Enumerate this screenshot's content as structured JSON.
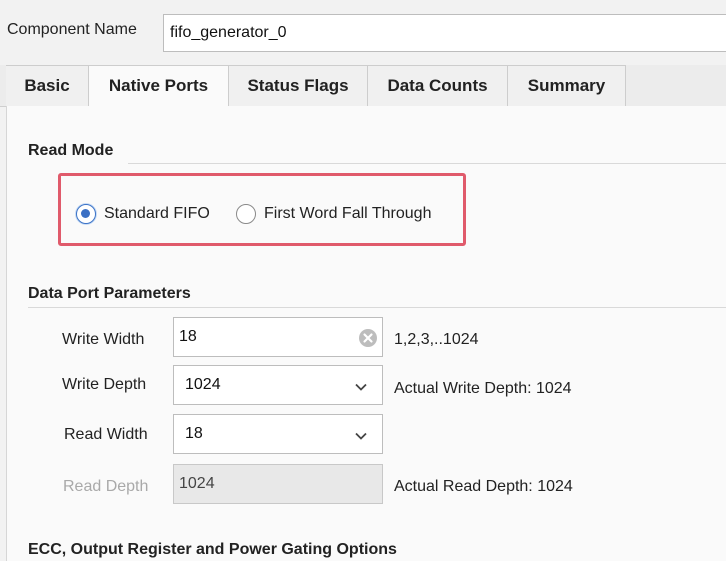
{
  "component": {
    "label": "Component Name",
    "value": "fifo_generator_0"
  },
  "tabs": [
    {
      "label": "Basic",
      "active": false
    },
    {
      "label": "Native Ports",
      "active": true
    },
    {
      "label": "Status Flags",
      "active": false
    },
    {
      "label": "Data Counts",
      "active": false
    },
    {
      "label": "Summary",
      "active": false
    }
  ],
  "read_mode": {
    "title": "Read Mode",
    "options": [
      {
        "label": "Standard FIFO",
        "selected": true
      },
      {
        "label": "First Word Fall Through",
        "selected": false
      }
    ],
    "highlight_color": "#e05a6b"
  },
  "data_port": {
    "title": "Data Port Parameters",
    "write_width": {
      "label": "Write Width",
      "value": "18",
      "hint": "1,2,3,..1024"
    },
    "write_depth": {
      "label": "Write Depth",
      "value": "1024",
      "hint": "Actual Write Depth: 1024"
    },
    "read_width": {
      "label": "Read Width",
      "value": "18"
    },
    "read_depth": {
      "label": "Read Depth",
      "value": "1024",
      "hint": "Actual Read Depth: 1024"
    }
  },
  "ecc": {
    "title": "ECC, Output Register and Power Gating Options"
  },
  "icons": {
    "clear": "clear-circle-x-icon",
    "dropdown": "chevron-down-icon"
  },
  "colors": {
    "radio_selected": "#3b70c4",
    "panel_bg": "#fafafa"
  }
}
